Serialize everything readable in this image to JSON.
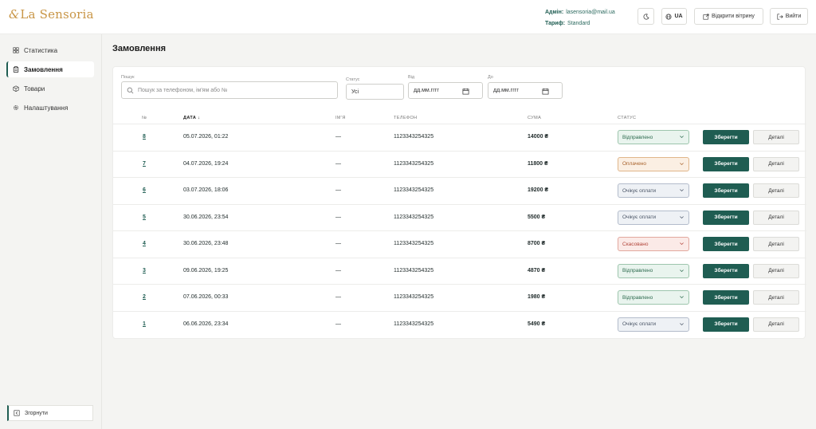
{
  "brand": {
    "logo_mark": "&",
    "logo_text": "La Sensoria"
  },
  "header": {
    "admin_label": "Адмін:",
    "admin_email": "lasensoria@mail.ua",
    "plan_label": "Тариф:",
    "plan_value": "Standard",
    "lang": "UA",
    "open_store": "Відкрити вітрину",
    "logout": "Вийти"
  },
  "sidebar": {
    "items": [
      {
        "label": "Статистика",
        "icon": "grid-icon"
      },
      {
        "label": "Замовлення",
        "icon": "clipboard-icon",
        "active": true
      },
      {
        "label": "Товари",
        "icon": "box-icon"
      },
      {
        "label": "Налаштування",
        "icon": "gear-icon"
      }
    ],
    "collapse": "Згорнути"
  },
  "page": {
    "title": "Замовлення"
  },
  "filters": {
    "search_label": "Пошук",
    "search_placeholder": "Пошук за телефоном, ім'ям або №",
    "status_label": "Статус",
    "status_value": "Усі",
    "from_label": "Від",
    "from_placeholder": "дд.мм.гггг",
    "to_label": "До",
    "to_placeholder": "дд.мм.гггг"
  },
  "table": {
    "headers": {
      "num": "№",
      "date": "ДАТА ↓",
      "name": "ІМ'Я",
      "phone": "ТЕЛЕФОН",
      "sum": "СУМА",
      "status": "СТАТУС"
    },
    "save_label": "Зберегти",
    "details_label": "Деталі",
    "rows": [
      {
        "num": "8",
        "date": "05.07.2026, 01:22",
        "name": "—",
        "phone": "1123343254325",
        "sum": "14000 ₴",
        "status": "Відправлено",
        "status_kind": "sent"
      },
      {
        "num": "7",
        "date": "04.07.2026, 19:24",
        "name": "—",
        "phone": "1123343254325",
        "sum": "11800 ₴",
        "status": "Оплачено",
        "status_kind": "paid"
      },
      {
        "num": "6",
        "date": "03.07.2026, 18:06",
        "name": "—",
        "phone": "1123343254325",
        "sum": "19200 ₴",
        "status": "Очікує оплати",
        "status_kind": "wait"
      },
      {
        "num": "5",
        "date": "30.06.2026, 23:54",
        "name": "—",
        "phone": "1123343254325",
        "sum": "5500 ₴",
        "status": "Очікує оплати",
        "status_kind": "wait"
      },
      {
        "num": "4",
        "date": "30.06.2026, 23:48",
        "name": "—",
        "phone": "1123343254325",
        "sum": "8700 ₴",
        "status": "Скасовано",
        "status_kind": "cancel"
      },
      {
        "num": "3",
        "date": "09.06.2026, 19:25",
        "name": "—",
        "phone": "1123343254325",
        "sum": "4870 ₴",
        "status": "Відправлено",
        "status_kind": "sent"
      },
      {
        "num": "2",
        "date": "07.06.2026, 00:33",
        "name": "—",
        "phone": "1123343254325",
        "sum": "1980 ₴",
        "status": "Відправлено",
        "status_kind": "sent"
      },
      {
        "num": "1",
        "date": "06.06.2026, 23:34",
        "name": "—",
        "phone": "1123343254325",
        "sum": "5490 ₴",
        "status": "Очікує оплати",
        "status_kind": "wait"
      }
    ]
  },
  "colors": {
    "accent": "#1f5d52",
    "brand": "#c99647"
  }
}
